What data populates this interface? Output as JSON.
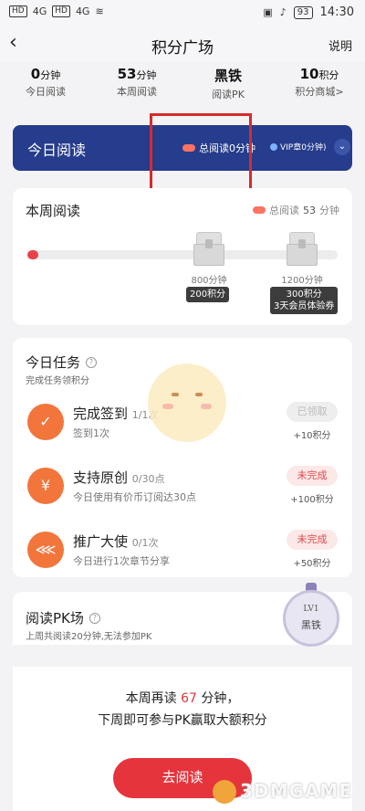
{
  "status_bar": {
    "left": [
      "HD",
      "4G",
      "HD",
      "4G"
    ],
    "battery": "93",
    "time": "14:30"
  },
  "nav": {
    "back": "‹",
    "title": "积分广场",
    "help": "说明"
  },
  "stats": [
    {
      "value": "0",
      "unit": "分钟",
      "label": "今日阅读"
    },
    {
      "value": "53",
      "unit": "分钟",
      "label": "本周阅读"
    },
    {
      "value": "黑铁",
      "unit": "",
      "label": "阅读PK"
    },
    {
      "value": "10",
      "unit": "积分",
      "label": "积分商城>"
    }
  ],
  "today_reading": {
    "title": "今日阅读",
    "total": "总阅读0分钟",
    "vip": "VIP章0分钟)",
    "chevron": "⌄"
  },
  "weekly": {
    "title": "本周阅读",
    "total_prefix": "总阅读",
    "total_value": "53",
    "total_suffix": "分钟",
    "progress": 0.03,
    "milestones": [
      {
        "minutes": "800分钟",
        "reward": "200积分"
      },
      {
        "minutes": "1200分钟",
        "reward": "300积分",
        "extra": "3天会员体验券"
      }
    ]
  },
  "tasks": {
    "title": "今日任务",
    "subtitle": "完成任务领积分",
    "items": [
      {
        "icon": "calendar-icon",
        "glyph": "✓",
        "name": "完成签到",
        "progress": "1/1次",
        "desc": "签到1次",
        "status": "已领取",
        "status_type": "done",
        "reward": "+10积分"
      },
      {
        "icon": "yen-icon",
        "glyph": "¥",
        "name": "支持原创",
        "progress": "0/30点",
        "desc": "今日使用有价币订阅达30点",
        "status": "未完成",
        "status_type": "todo",
        "reward": "+100积分"
      },
      {
        "icon": "share-icon",
        "glyph": "⋘",
        "name": "推广大使",
        "progress": "0/1次",
        "desc": "今日进行1次章节分享",
        "status": "未完成",
        "status_type": "todo",
        "reward": "+50积分"
      }
    ]
  },
  "pk": {
    "title": "阅读PK场",
    "subtitle": "上周共阅读20分钟,无法参加PK",
    "badge_level": "LV1",
    "badge_rank": "黑铁",
    "msg_prefix": "本周再读 ",
    "msg_number": "67",
    "msg_suffix": " 分钟，",
    "msg_line2": "下周即可参与PK赢取大额积分",
    "button": "去阅读"
  },
  "watermark": "3DMGAME",
  "colors": {
    "banner": "#263c8c",
    "accent_red": "#e5343c",
    "task_icon": "#f2753b"
  }
}
